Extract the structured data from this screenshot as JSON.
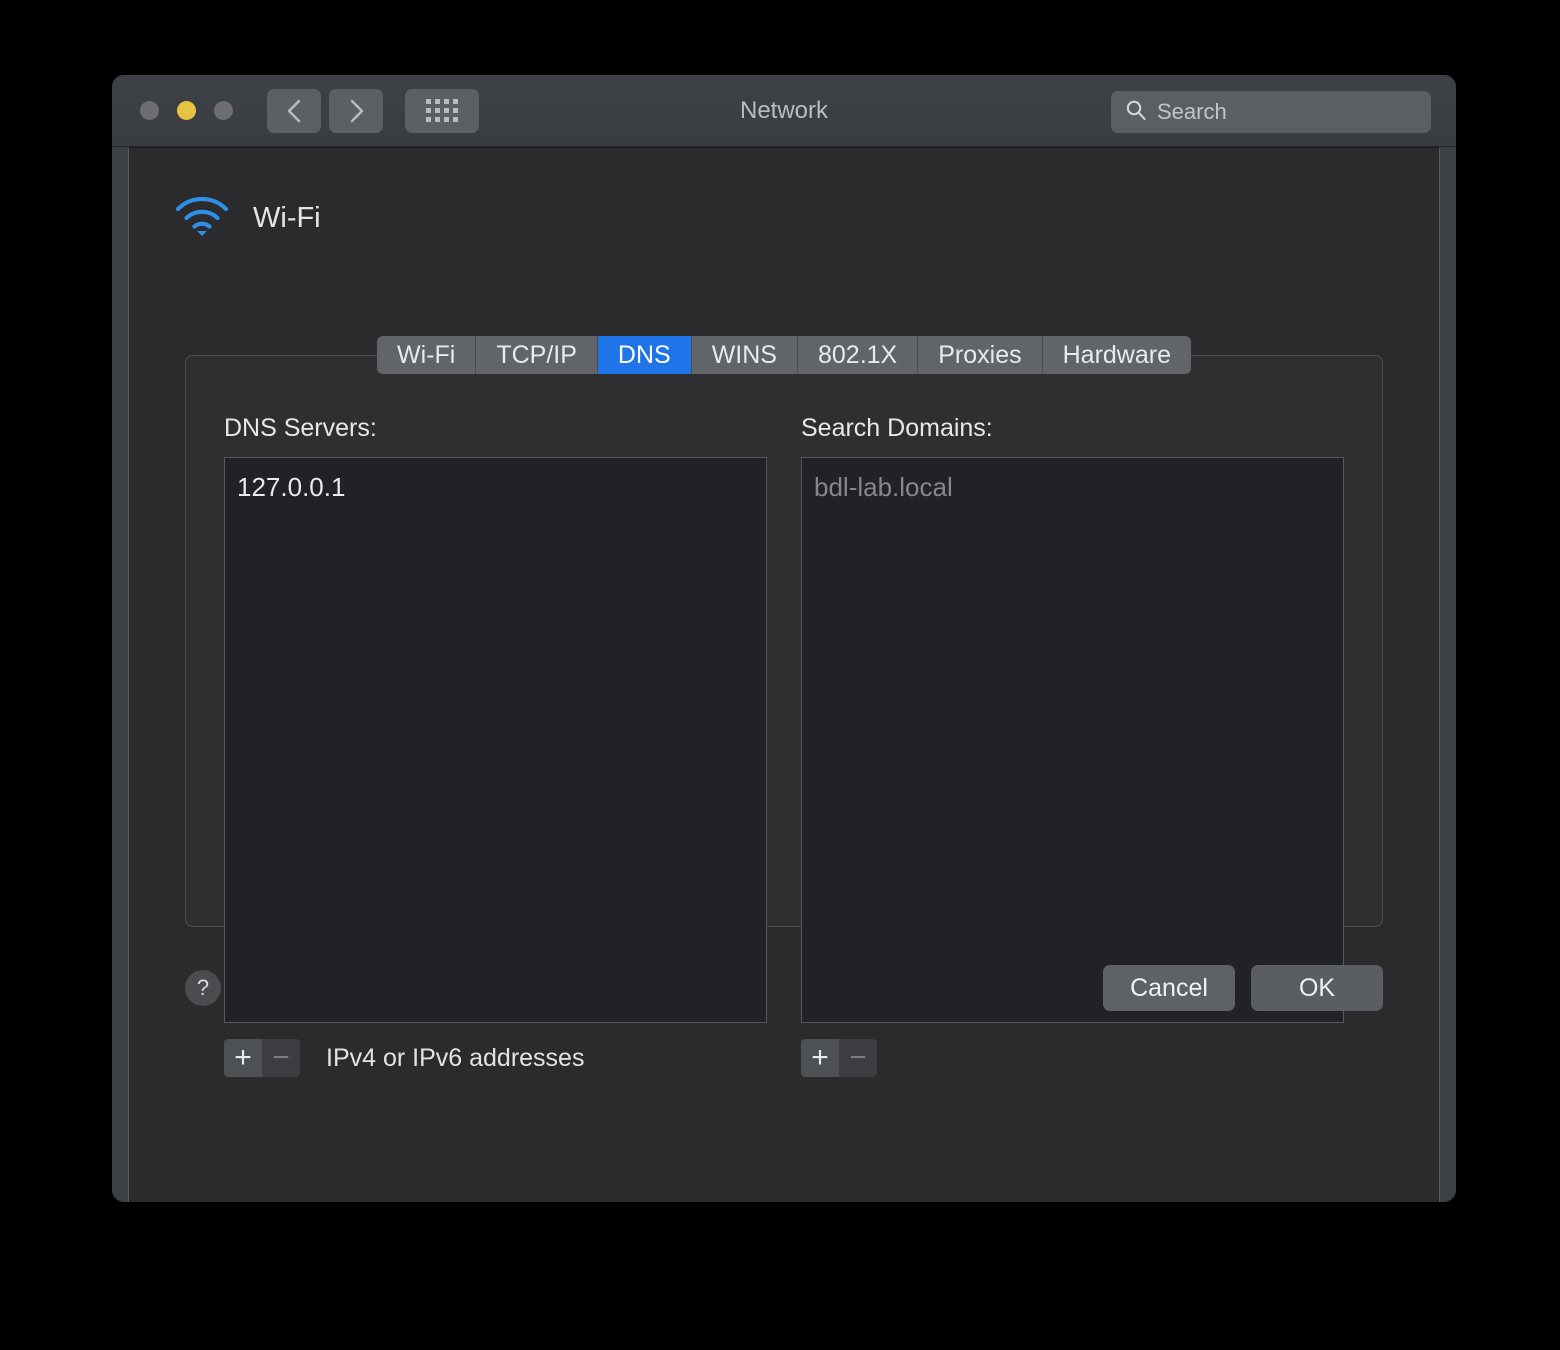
{
  "window": {
    "title": "Network",
    "traffic_lights": [
      {
        "name": "close",
        "color": "#6c6e72"
      },
      {
        "name": "minimize",
        "color": "#e8c341"
      },
      {
        "name": "zoom",
        "color": "#6c6e72"
      }
    ],
    "nav": {
      "back_icon": "chevron-left-icon",
      "forward_icon": "chevron-right-icon",
      "grid_icon": "show-all-grid-icon"
    },
    "search": {
      "icon": "search-icon",
      "placeholder": "Search",
      "value": ""
    }
  },
  "interface": {
    "icon": "wifi-icon",
    "name": "Wi-Fi"
  },
  "tabs": [
    {
      "label": "Wi-Fi",
      "active": false
    },
    {
      "label": "TCP/IP",
      "active": false
    },
    {
      "label": "DNS",
      "active": true
    },
    {
      "label": "WINS",
      "active": false
    },
    {
      "label": "802.1X",
      "active": false
    },
    {
      "label": "Proxies",
      "active": false
    },
    {
      "label": "Hardware",
      "active": false
    }
  ],
  "dns_servers": {
    "label": "DNS Servers:",
    "entries": [
      {
        "value": "127.0.0.1",
        "dim": false
      }
    ],
    "hint": "IPv4 or IPv6 addresses",
    "add_label": "+",
    "remove_label": "−"
  },
  "search_domains": {
    "label": "Search Domains:",
    "entries": [
      {
        "value": "bdl-lab.local",
        "dim": true
      }
    ],
    "add_label": "+",
    "remove_label": "−"
  },
  "footer": {
    "help_label": "?",
    "cancel_label": "Cancel",
    "ok_label": "OK"
  },
  "colors": {
    "accent": "#1f74ea",
    "wifi_icon": "#2f8fe8",
    "window_frame": "#3c3f44",
    "sheet_bg": "#2b2b2d",
    "panel_bg": "#2f2f31",
    "listbox_bg": "#212226",
    "minimize_yellow": "#e8c341"
  }
}
